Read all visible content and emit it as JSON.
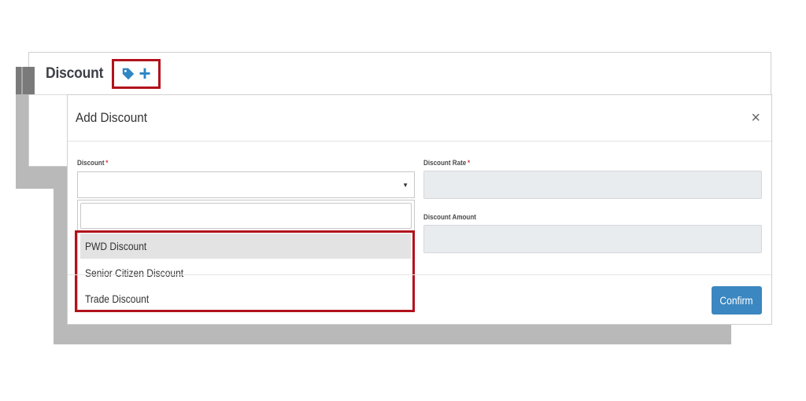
{
  "panel": {
    "title": "Discount",
    "add_icon": "tag-plus-icon"
  },
  "modal": {
    "title": "Add Discount",
    "close_label": "×",
    "fields": {
      "discount_label": "Discount",
      "discount_rate_label": "Discount Rate",
      "discount_amount_label": "Discount Amount",
      "required_marker": "*",
      "discount_value": "",
      "discount_rate_value": "",
      "discount_amount_value": ""
    },
    "dropdown": {
      "search_value": "",
      "options": [
        "PWD Discount",
        "Senior Citizen Discount",
        "Trade Discount"
      ],
      "highlighted_index": 0
    },
    "confirm_label": "Confirm"
  },
  "colors": {
    "accent": "#3a87c1",
    "highlight_border": "#b2121c",
    "required": "#d13b3b",
    "readonly_bg": "#e9ecef"
  }
}
